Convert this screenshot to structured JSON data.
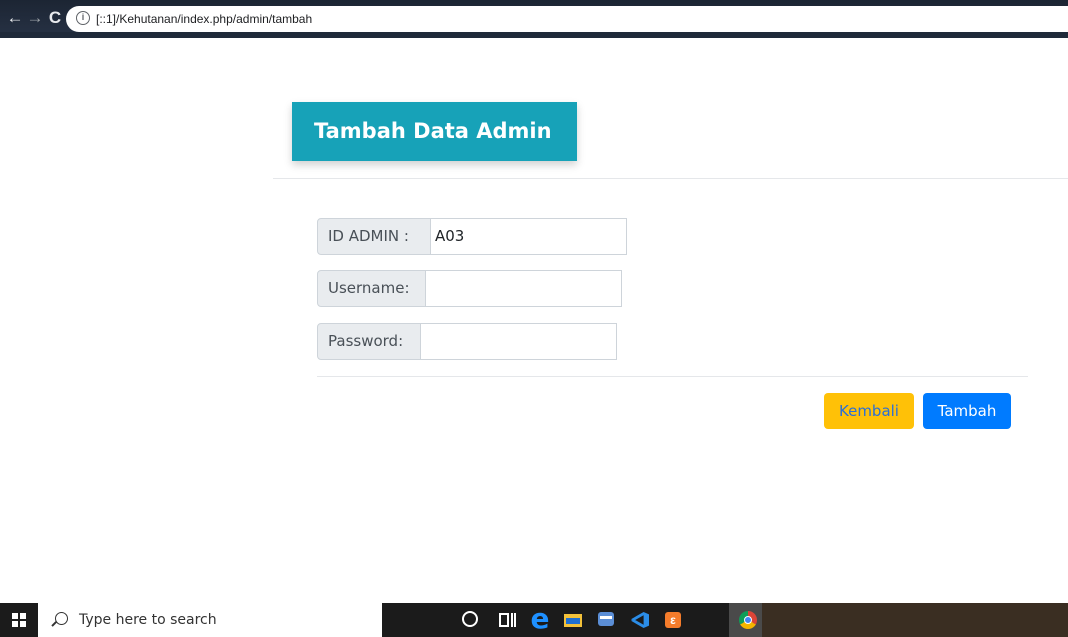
{
  "browser": {
    "url": "[::1]/Kehutanan/index.php/admin/tambah",
    "info_glyph": "i",
    "back_glyph": "←",
    "forward_glyph": "→",
    "reload_glyph": "C"
  },
  "page": {
    "title": "Tambah Data Admin"
  },
  "form": {
    "fields": [
      {
        "label": "ID ADMIN :",
        "value": "A03",
        "placeholder": ""
      },
      {
        "label": "Username:",
        "value": "",
        "placeholder": ""
      },
      {
        "label": "Password:",
        "value": "",
        "placeholder": ""
      }
    ],
    "buttons": {
      "back_label": "Kembali",
      "add_label": "Tambah"
    }
  },
  "colors": {
    "header_bg": "#17a2b8",
    "btn_back_bg": "#ffc107",
    "btn_add_bg": "#007bff"
  },
  "taskbar": {
    "search_text": "Type here to search",
    "icons": [
      "windows-icon",
      "search-icon",
      "cortana-icon",
      "task-view-icon",
      "edge-icon",
      "file-explorer-icon",
      "store-icon",
      "vscode-icon",
      "xampp-icon",
      "chrome-icon"
    ],
    "edge_glyph": "e",
    "xampp_glyph": "ε"
  }
}
